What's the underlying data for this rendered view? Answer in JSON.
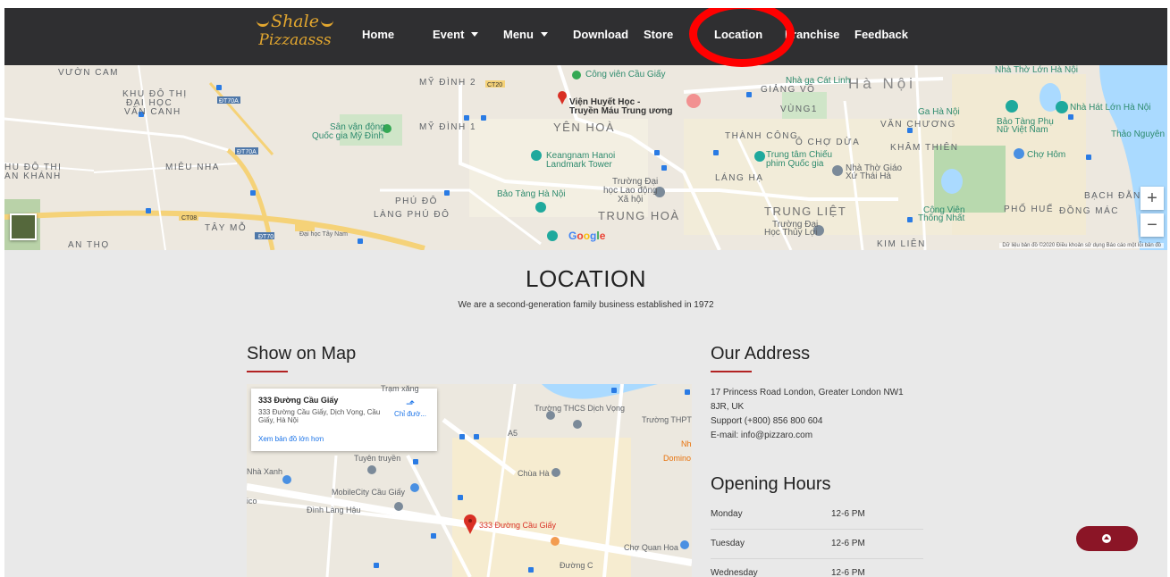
{
  "brand": {
    "logo_line1": "Shale",
    "logo_line2": "Pizzaasss"
  },
  "nav": {
    "home": "Home",
    "event": "Event",
    "menu": "Menu",
    "download": "Download",
    "store": "Store",
    "location": "Location",
    "franchise": "Franchise",
    "feedback": "Feedback"
  },
  "top_map": {
    "labels": {
      "vuon_cam": "VƯỜN CAM",
      "khu_do_thi_1": "KHU ĐÔ THỊ",
      "khu_do_thi_2": "ĐẠI HỌC",
      "khu_do_thi_3": "VĂN CANH",
      "hu_do_thi_1": "HU ĐÔ THỊ",
      "hu_do_thi_2": "AN KHÁNH",
      "mieu_nha": "MIÊU NHA",
      "tay_mo": "TÂY MỖ",
      "an_tho": "AN THỌ",
      "my_dinh_2": "MỸ ĐÌNH 2",
      "my_dinh_1": "MỸ ĐÌNH 1",
      "svd_1": "Sân vận động",
      "svd_2": "Quốc gia Mỹ Đình",
      "vien_1": "Viện Huyết Học -",
      "vien_2": "Truyền Máu Trung ương",
      "yen_hoa": "YÊN HOÀ",
      "cong_vien_cau_giay": "Công viên Cầu Giấy",
      "keangnam_1": "Keangnam Hanoi",
      "keangnam_2": "Landmark Tower",
      "bao_tang_ha_noi": "Bảo Tàng Hà Nội",
      "truong_dai_hoc_1": "Trường Đại",
      "truong_dai_hoc_2": "học Lao động",
      "truong_dai_hoc_3": "Xã hội",
      "phu_do": "PHÚ ĐÔ",
      "lang_phu_do": "LÀNG PHÚ ĐÔ",
      "trung_hoa": "TRUNG HOÀ",
      "giang_vo": "GIẢNG VÕ",
      "ha_noi": "Hà Nội",
      "vung1": "VÙNG1",
      "thanh_cong": "THÀNH CÔNG",
      "o_cho_dua": "Ô CHỢ DỪA",
      "van_chuong": "VĂN CHƯƠNG",
      "kham_thien": "KHÂM THIÊN",
      "trung_tam_chieu_1": "Trung tâm Chiếu",
      "trung_tam_chieu_2": "phim Quốc gia",
      "nha_tho_1": "Nhà Thờ Giáo",
      "nha_tho_2": "Xứ Thái Hà",
      "lang_ha": "LÁNG HẠ",
      "trung_liet": "TRUNG LIỆT",
      "thuy_loi_1": "Trường Đại",
      "thuy_loi_2": "Học Thủy Lợi",
      "kim_lien": "KIM LIÊN",
      "cong_vien_tn_1": "Công Viên",
      "cong_vien_tn_2": "Thống Nhất",
      "pho_hue": "PHỐ HUẾ",
      "dong_mac": "ĐỒNG MÁC",
      "bach_dang": "BẠCH ĐẰNG",
      "bao_tang_phu_nu_1": "Bảo Tàng Phụ",
      "bao_tang_phu_nu_2": "Nữ Việt Nam",
      "thao_nguyen": "Thảo Nguyên I",
      "cho_hom": "Chợ Hôm",
      "nha_hat_lon": "Nhà Hát Lớn Hà Nội",
      "ga_ha_noi": "Ga Hà Nội",
      "nha_ga_cat_linh": "Nhà ga Cát Linh",
      "nha_tho_lon": "Nhà Thờ Lớn Hà Nội",
      "dai_hoc_tay_nam": "Đại học Tây Nam",
      "road_ct20": "CT20",
      "road_dt70a": "ĐT70A",
      "road_ct08": "CT08",
      "road_dt70": "ĐT70"
    },
    "google": "Google",
    "zoom_in": "+",
    "zoom_out": "−",
    "footer": "Dữ liệu bản đồ ©2020   Điều khoản sử dụng   Báo cáo một lỗi bản đồ"
  },
  "section": {
    "title": "LOCATION",
    "subtitle": "We are a second-generation family business established in 1972"
  },
  "show_on_map": {
    "heading": "Show on Map",
    "card_title": "333 Đường Cầu Giấy",
    "card_address": "333 Đường Cầu Giấy, Dịch Vọng, Cầu Giấy, Hà Nội",
    "card_link": "Xem bản đồ lớn hơn",
    "card_directions": "Chỉ đườ...",
    "labels": {
      "tram_xang": "Trạm xăng",
      "truong_thcs": "Trường THCS Dịch Vọng",
      "truong_thpt": "Trường THPT",
      "nhaxanh": "Nhà Xanh",
      "tuyen_truyen": "Tuyên truyền",
      "chua_ha": "Chùa Hà",
      "domino": "Domino",
      "nh": "Nh",
      "mobilecity": "MobileCity Cầu Giấy",
      "dinh_lang_hau": "Đình Làng Hậu",
      "pin_label": "333 Đường Cầu Giấy",
      "cho_quan_hoa": "Chợ Quan Hoa",
      "ico": "ico",
      "duong_c": "Đường C",
      "a5": "A5"
    }
  },
  "our_address": {
    "heading": "Our Address",
    "line1": "17 Princess Road London, Greater London NW1",
    "line2": "8JR, UK",
    "line3": "Support (+800) 856 800 604",
    "line4": "E-mail: info@pizzaro.com"
  },
  "opening_hours": {
    "heading": "Opening Hours",
    "rows": [
      {
        "day": "Monday",
        "time": "12-6 PM"
      },
      {
        "day": "Tuesday",
        "time": "12-6 PM"
      },
      {
        "day": "Wednesday",
        "time": "12-6 PM"
      }
    ]
  },
  "colors": {
    "nav_bg": "#2f2f31",
    "accent_red": "#b22222",
    "scroll_btn": "#8b1526",
    "highlight_ring": "#ff0000",
    "logo": "#e3a72f"
  },
  "icons": {
    "scroll_top": "arrow-up-icon",
    "map_pin": "map-pin-icon",
    "directions": "directions-icon"
  }
}
